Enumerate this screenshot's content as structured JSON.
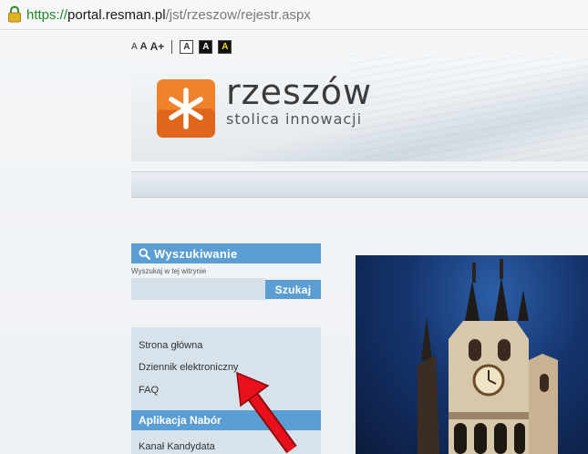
{
  "browser": {
    "url_scheme": "https://",
    "url_host": "portal.resman.pl",
    "url_path": "/jst/rzeszow/rejestr.aspx",
    "lock_icon": "lock-icon"
  },
  "accessibility": {
    "size_normal": "A",
    "size_bold": "A",
    "size_plus": "A+",
    "contrast_labels": [
      "A",
      "A",
      "A"
    ]
  },
  "header": {
    "logo_name": "rzeszów",
    "logo_tagline": "stolica innowacji",
    "logo_color": "#f0822c"
  },
  "search": {
    "title": "Wyszukiwanie",
    "hint": "Wyszukaj w tej witrynie",
    "value": "",
    "button_label": "Szukaj",
    "icon": "search-icon"
  },
  "menu": {
    "items": [
      "Strona główna",
      "Dziennik elektroniczny",
      "FAQ"
    ],
    "section_title": "Aplikacja Nabór",
    "section_items": [
      "Kanał Kandydata"
    ]
  },
  "colors": {
    "accent": "#5b9ed4",
    "arrow": "#e8101a",
    "secure_green": "#1b8a2a"
  }
}
